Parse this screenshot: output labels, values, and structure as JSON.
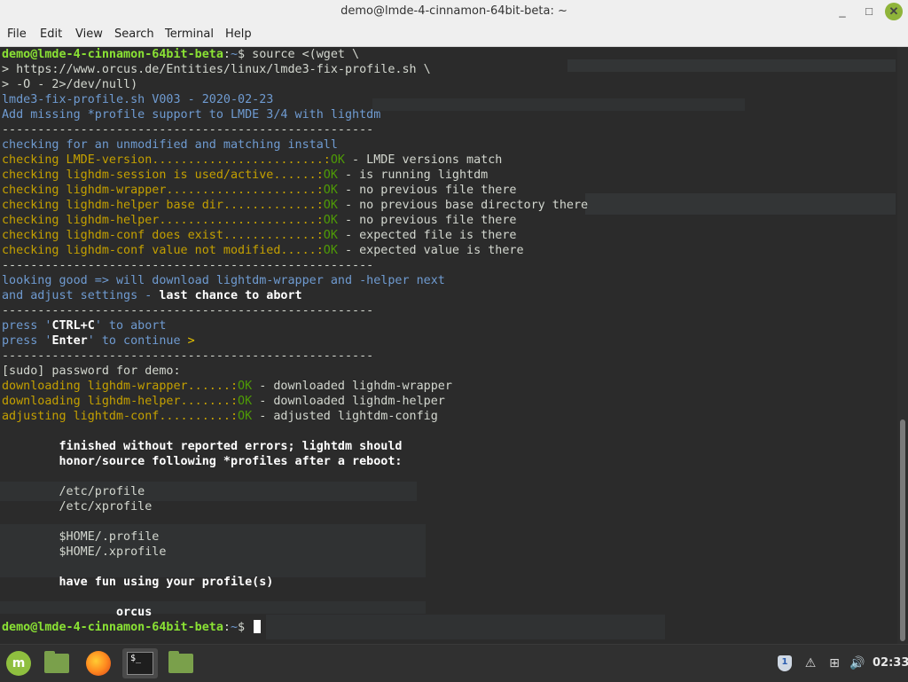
{
  "window": {
    "title": "demo@lmde-4-cinnamon-64bit-beta: ~",
    "minimize_glyph": "_",
    "maximize_glyph": "□",
    "close_glyph": "✕"
  },
  "menubar": [
    "File",
    "Edit",
    "View",
    "Search",
    "Terminal",
    "Help"
  ],
  "terminal": {
    "lines": [
      [
        {
          "t": "demo@lmde-4-cinnamon-64bit-beta",
          "c": "g"
        },
        {
          "t": ":",
          "c": "w"
        },
        {
          "t": "~",
          "c": "b"
        },
        {
          "t": "$ source <(wget \\",
          "c": "w"
        }
      ],
      [
        {
          "t": "> https://www.orcus.de/Entities/linux/lmde3-fix-profile.sh \\",
          "c": "w"
        }
      ],
      [
        {
          "t": "> -O - 2>/dev/null)",
          "c": "w"
        }
      ],
      [
        {
          "t": "lmde3-fix-profile.sh V003 - 2020-02-23",
          "c": "b"
        }
      ],
      [
        {
          "t": "Add missing *profile support to LMDE 3/4 with lightdm",
          "c": "b"
        }
      ],
      [
        {
          "t": "----------------------------------------------------",
          "c": "dash"
        }
      ],
      [
        {
          "t": "checking for an unmodified and matching install",
          "c": "b"
        }
      ],
      [
        {
          "t": "checking LMDE-version........................:",
          "c": "o"
        },
        {
          "t": "OK",
          "c": "ok"
        },
        {
          "t": " - LMDE versions match",
          "c": "w"
        }
      ],
      [
        {
          "t": "checking lighdm-session is used/active......:",
          "c": "o"
        },
        {
          "t": "OK",
          "c": "ok"
        },
        {
          "t": " - is running lightdm",
          "c": "w"
        }
      ],
      [
        {
          "t": "checking lighdm-wrapper.....................:",
          "c": "o"
        },
        {
          "t": "OK",
          "c": "ok"
        },
        {
          "t": " - no previous file there",
          "c": "w"
        }
      ],
      [
        {
          "t": "checking lighdm-helper base dir.............:",
          "c": "o"
        },
        {
          "t": "OK",
          "c": "ok"
        },
        {
          "t": " - no previous base directory there",
          "c": "w"
        }
      ],
      [
        {
          "t": "checking lighdm-helper......................:",
          "c": "o"
        },
        {
          "t": "OK",
          "c": "ok"
        },
        {
          "t": " - no previous file there",
          "c": "w"
        }
      ],
      [
        {
          "t": "checking lighdm-conf does exist.............:",
          "c": "o"
        },
        {
          "t": "OK",
          "c": "ok"
        },
        {
          "t": " - expected file is there",
          "c": "w"
        }
      ],
      [
        {
          "t": "checking lighdm-conf value not modified.....:",
          "c": "o"
        },
        {
          "t": "OK",
          "c": "ok"
        },
        {
          "t": " - expected value is there",
          "c": "w"
        }
      ],
      [
        {
          "t": "----------------------------------------------------",
          "c": "dash"
        }
      ],
      [
        {
          "t": "looking good => will download lightdm-wrapper and -helper next",
          "c": "b"
        }
      ],
      [
        {
          "t": "and adjust settings - ",
          "c": "b"
        },
        {
          "t": "last chance to abort",
          "c": "wb"
        }
      ],
      [
        {
          "t": "----------------------------------------------------",
          "c": "dash"
        }
      ],
      [
        {
          "t": "press '",
          "c": "b"
        },
        {
          "t": "CTRL+C",
          "c": "wb"
        },
        {
          "t": "' to abort",
          "c": "b"
        }
      ],
      [
        {
          "t": "press '",
          "c": "b"
        },
        {
          "t": "Enter",
          "c": "wb"
        },
        {
          "t": "' to continue ",
          "c": "b"
        },
        {
          "t": ">",
          "c": "k"
        }
      ],
      [
        {
          "t": "----------------------------------------------------",
          "c": "dash"
        }
      ],
      [
        {
          "t": "[sudo] password for demo:",
          "c": "w"
        }
      ],
      [
        {
          "t": "downloading lighdm-wrapper......:",
          "c": "o"
        },
        {
          "t": "OK",
          "c": "ok"
        },
        {
          "t": " - downloaded lighdm-wrapper",
          "c": "w"
        }
      ],
      [
        {
          "t": "downloading lighdm-helper.......:",
          "c": "o"
        },
        {
          "t": "OK",
          "c": "ok"
        },
        {
          "t": " - downloaded lighdm-helper",
          "c": "w"
        }
      ],
      [
        {
          "t": "adjusting lightdm-conf..........:",
          "c": "o"
        },
        {
          "t": "OK",
          "c": "ok"
        },
        {
          "t": " - adjusted lightdm-config",
          "c": "w"
        }
      ],
      [
        {
          "t": "",
          "c": "w"
        }
      ],
      [
        {
          "t": "        finished without reported errors; lightdm should",
          "c": "wb"
        }
      ],
      [
        {
          "t": "        honor/source following *profiles after a reboot:",
          "c": "wb"
        }
      ],
      [
        {
          "t": "",
          "c": "w"
        }
      ],
      [
        {
          "t": "        /etc/profile",
          "c": "w"
        }
      ],
      [
        {
          "t": "        /etc/xprofile",
          "c": "w"
        }
      ],
      [
        {
          "t": "",
          "c": "w"
        }
      ],
      [
        {
          "t": "        $HOME/.profile",
          "c": "w"
        }
      ],
      [
        {
          "t": "        $HOME/.xprofile",
          "c": "w"
        }
      ],
      [
        {
          "t": "",
          "c": "w"
        }
      ],
      [
        {
          "t": "        have fun using your profile(s)",
          "c": "wb"
        }
      ],
      [
        {
          "t": "",
          "c": "w"
        }
      ],
      [
        {
          "t": "                orcus",
          "c": "wb"
        }
      ],
      [
        {
          "t": "demo@lmde-4-cinnamon-64bit-beta",
          "c": "g"
        },
        {
          "t": ":",
          "c": "w"
        },
        {
          "t": "~",
          "c": "b"
        },
        {
          "t": "$ ",
          "c": "w"
        }
      ]
    ]
  },
  "taskbar": {
    "menu_glyph": "m",
    "terminal_glyph": "$_",
    "shield_glyph": "1",
    "warning_glyph": "⚠",
    "network_glyph": "⊞",
    "volume_glyph": "🔊",
    "clock": "02:33"
  },
  "colors": {
    "prompt_user": "#8ae234",
    "prompt_path": "#6f9bd1",
    "blue_text": "#6f9bd1",
    "yellow_text": "#c4a000",
    "ok_green": "#4e9a06",
    "terminal_bg": "#2b2b2b"
  }
}
